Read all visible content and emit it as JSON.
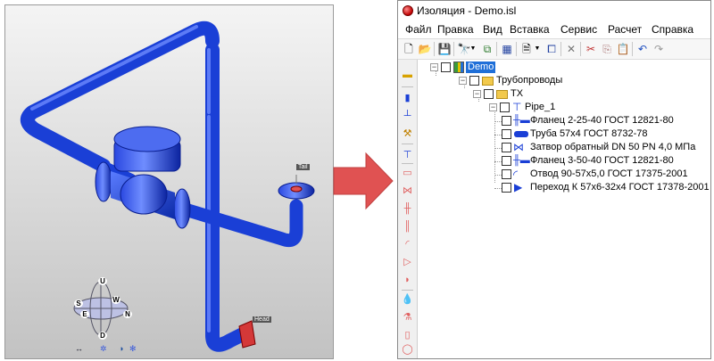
{
  "viewport": {
    "tail_label": "Tail",
    "head_label": "Head",
    "compass": [
      "U",
      "E",
      "S",
      "N",
      "W",
      "D"
    ],
    "nav_icons": [
      "arrow-left-right-icon",
      "orbit-icon",
      "globe-icon",
      "settings-icon"
    ]
  },
  "window": {
    "title": "Изоляция - Demo.isl",
    "menu": [
      "Файл",
      "Правка",
      "Вид",
      "Вставка",
      "Сервис",
      "Расчет",
      "Справка"
    ]
  },
  "tree": {
    "root": "Demo",
    "group": "Трубопроводы",
    "subgroup": "TX",
    "pipe": "Pipe_1",
    "items": [
      {
        "label": "Фланец 2-25-40 ГОСТ 12821-80",
        "icon": "flange-icon"
      },
      {
        "label": "Труба 57х4 ГОСТ 8732-78",
        "icon": "pipe-icon"
      },
      {
        "label": "Затвор обратный DN 50 PN 4,0 МПа",
        "icon": "valve-icon"
      },
      {
        "label": "Фланец 3-50-40 ГОСТ 12821-80",
        "icon": "flange-icon"
      },
      {
        "label": "Отвод 90-57х5,0 ГОСТ 17375-2001",
        "icon": "elbow-icon"
      },
      {
        "label": "Переход К 57х6-32х4 ГОСТ 17378-2001",
        "icon": "reducer-icon"
      }
    ]
  },
  "colors": {
    "pipe": "#1a3fd6",
    "accent": "#e05252",
    "selection": "#1f6fd8"
  }
}
